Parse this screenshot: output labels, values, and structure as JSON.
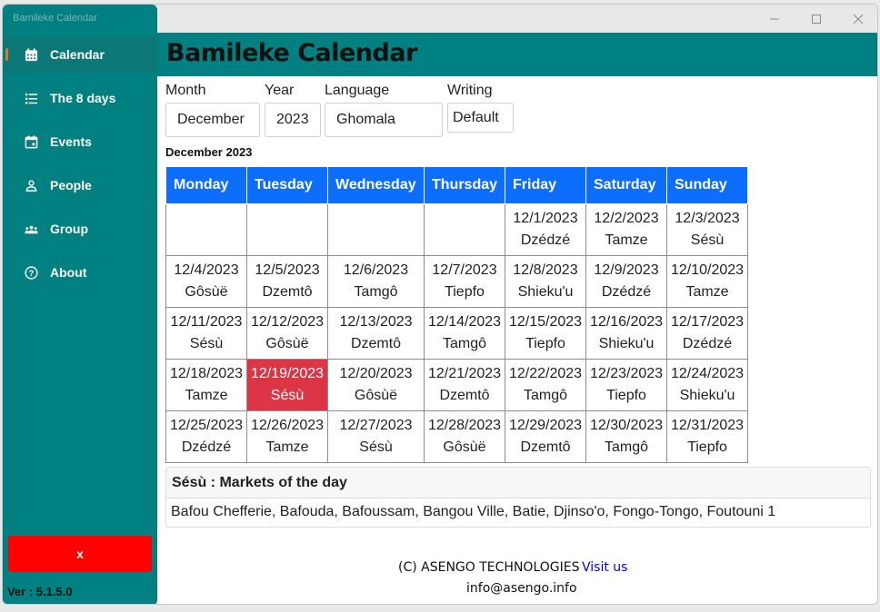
{
  "window": {
    "app_title": "Bamileke Calendar"
  },
  "sidebar": {
    "items": [
      {
        "label": "Calendar",
        "icon": "calendar-grid-icon"
      },
      {
        "label": "The 8 days",
        "icon": "list-icon"
      },
      {
        "label": "Events",
        "icon": "calendar-event-icon"
      },
      {
        "label": "People",
        "icon": "person-icon"
      },
      {
        "label": "Group",
        "icon": "group-icon"
      },
      {
        "label": "About",
        "icon": "question-circle-icon"
      }
    ],
    "x_label": "x",
    "version": "Ver : 5.1.5.0"
  },
  "header": {
    "title": "Bamileke Calendar"
  },
  "filters": {
    "month": {
      "label": "Month",
      "value": "December"
    },
    "year": {
      "label": "Year",
      "value": "2023"
    },
    "language": {
      "label": "Language",
      "value": "Ghomala"
    },
    "writing": {
      "label": "Writing",
      "value": "Default"
    }
  },
  "calendar": {
    "heading": "December 2023",
    "days": [
      "Monday",
      "Tuesday",
      "Wednesday",
      "Thursday",
      "Friday",
      "Saturday",
      "Sunday"
    ],
    "weeks": [
      [
        null,
        null,
        null,
        null,
        {
          "date": "12/1/2023",
          "name": "Dzédzé"
        },
        {
          "date": "12/2/2023",
          "name": "Tamze"
        },
        {
          "date": "12/3/2023",
          "name": "Sésù"
        }
      ],
      [
        {
          "date": "12/4/2023",
          "name": "Gôsùë"
        },
        {
          "date": "12/5/2023",
          "name": "Dzemtô"
        },
        {
          "date": "12/6/2023",
          "name": "Tamgô"
        },
        {
          "date": "12/7/2023",
          "name": "Tiepfo"
        },
        {
          "date": "12/8/2023",
          "name": "Shieku'u"
        },
        {
          "date": "12/9/2023",
          "name": "Dzédzé"
        },
        {
          "date": "12/10/2023",
          "name": "Tamze"
        }
      ],
      [
        {
          "date": "12/11/2023",
          "name": "Sésù"
        },
        {
          "date": "12/12/2023",
          "name": "Gôsùë"
        },
        {
          "date": "12/13/2023",
          "name": "Dzemtô"
        },
        {
          "date": "12/14/2023",
          "name": "Tamgô"
        },
        {
          "date": "12/15/2023",
          "name": "Tiepfo"
        },
        {
          "date": "12/16/2023",
          "name": "Shieku'u"
        },
        {
          "date": "12/17/2023",
          "name": "Dzédzé"
        }
      ],
      [
        {
          "date": "12/18/2023",
          "name": "Tamze"
        },
        {
          "date": "12/19/2023",
          "name": "Sésù",
          "today": true
        },
        {
          "date": "12/20/2023",
          "name": "Gôsùë"
        },
        {
          "date": "12/21/2023",
          "name": "Dzemtô"
        },
        {
          "date": "12/22/2023",
          "name": "Tamgô"
        },
        {
          "date": "12/23/2023",
          "name": "Tiepfo"
        },
        {
          "date": "12/24/2023",
          "name": "Shieku'u"
        }
      ],
      [
        {
          "date": "12/25/2023",
          "name": "Dzédzé"
        },
        {
          "date": "12/26/2023",
          "name": "Tamze"
        },
        {
          "date": "12/27/2023",
          "name": "Sésù"
        },
        {
          "date": "12/28/2023",
          "name": "Gôsùë"
        },
        {
          "date": "12/29/2023",
          "name": "Dzemtô"
        },
        {
          "date": "12/30/2023",
          "name": "Tamgô"
        },
        {
          "date": "12/31/2023",
          "name": "Tiepfo"
        }
      ]
    ]
  },
  "markets": {
    "title": "Sésù : Markets of the day",
    "list": "Bafou Chefferie, Bafouda, Bafoussam, Bangou Ville, Batie, Djinso'o, Fongo-Tongo, Foutouni 1"
  },
  "footer": {
    "copyright": "(C) ASENGO TECHNOLOGIES",
    "visit_label": "Visit us",
    "email": "info@asengo.info"
  },
  "colors": {
    "teal": "#008080",
    "header_blue": "#0d6efd",
    "today_red": "#dc3545",
    "close_red": "#ff0000"
  }
}
